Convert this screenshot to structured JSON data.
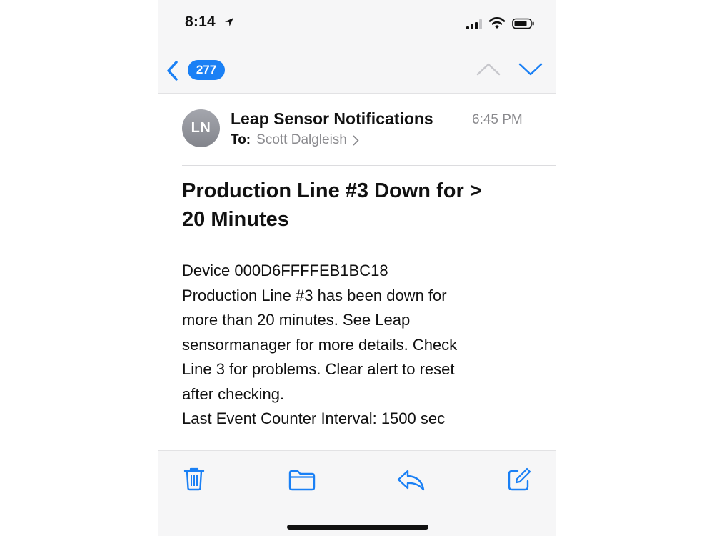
{
  "status_bar": {
    "time": "8:14"
  },
  "nav": {
    "message_count": "277"
  },
  "email": {
    "avatar_initials": "LN",
    "sender": "Leap Sensor Notifications",
    "time": "6:45 PM",
    "to_label": "To:",
    "to_name": "Scott Dalgleish",
    "subject_lines": [
      "Production Line #3 Down for >",
      "20 Minutes"
    ],
    "body_lines": [
      "Device 000D6FFFFEB1BC18",
      "Production Line #3 has been down for",
      "more than 20 minutes.  See Leap",
      "sensormanager for more details.  Check",
      "Line 3 for problems.  Clear alert to reset",
      "after checking.",
      "Last Event Counter Interval: 1500 sec"
    ]
  },
  "colors": {
    "accent": "#1a80f5",
    "muted": "#8a8a8e",
    "bar_bg": "#f6f6f7"
  },
  "toolbar_icons": [
    "trash-icon",
    "folder-icon",
    "reply-icon",
    "compose-icon"
  ]
}
